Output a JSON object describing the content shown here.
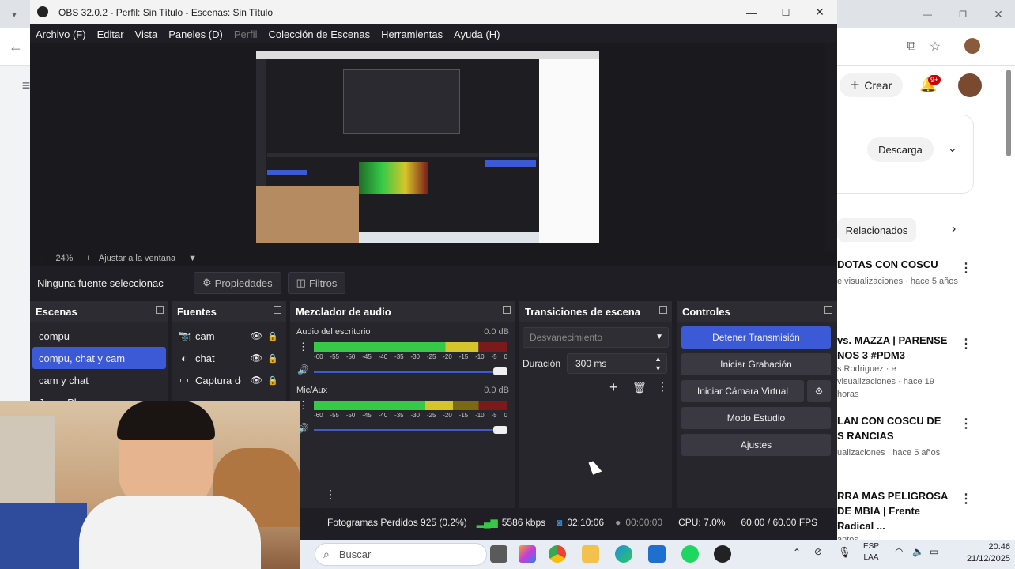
{
  "browser": {
    "create_label": "Crear",
    "notif_badge": "9+",
    "download_label": "Descarga",
    "related_label": "Relacionados",
    "videos": [
      {
        "title": "DOTAS CON COSCU",
        "meta": "e visualizaciones · hace 5 años"
      },
      {
        "title": "vs. MAZZA  | PARENSE NOS 3 #PDM3",
        "meta": "s Rodriguez · e visualizaciones · hace 19 horas"
      },
      {
        "title": "LAN CON COSCU DE S RANCIAS",
        "meta": "ualizaciones · hace 5 años"
      },
      {
        "title": "RRA MAS PELIGROSA DE MBIA | Frente Radical ...",
        "meta": "antos"
      }
    ]
  },
  "obs": {
    "window_title": "OBS 32.0.2 - Perfil: Sin Título - Escenas: Sin Título",
    "menu": [
      "Archivo (F)",
      "Editar",
      "Vista",
      "Paneles (D)",
      "Perfil",
      "Colección de Escenas",
      "Herramientas",
      "Ayuda (H)"
    ],
    "zoom": {
      "percent": "24%",
      "fit_label": "Ajustar a la ventana"
    },
    "no_source": "Ninguna fuente seleccionac",
    "properties_label": "Propiedades",
    "filters_label": "Filtros",
    "scenes": {
      "title": "Escenas",
      "items": [
        "compu",
        "compu, chat y cam",
        "cam y chat",
        "Jugar Play"
      ],
      "selected": 1
    },
    "sources": {
      "title": "Fuentes",
      "items": [
        {
          "name": "cam",
          "icon": "camera-icon"
        },
        {
          "name": "chat",
          "icon": "globe-icon"
        },
        {
          "name": "Captura de",
          "icon": "monitor-icon"
        }
      ]
    },
    "mixer": {
      "title": "Mezclador de audio",
      "channels": [
        {
          "name": "Audio del escritorio",
          "db": "0.0 dB",
          "level": 0.85
        },
        {
          "name": "Mic/Aux",
          "db": "0.0 dB",
          "level": 0.72
        }
      ],
      "scale": [
        "-60",
        "-55",
        "-50",
        "-45",
        "-40",
        "-35",
        "-30",
        "-25",
        "-20",
        "-15",
        "-10",
        "-5",
        "0"
      ]
    },
    "transitions": {
      "title": "Transiciones de escena",
      "selected": "Desvanecimiento",
      "duration_label": "Duración",
      "duration_value": "300 ms"
    },
    "controls": {
      "title": "Controles",
      "stop_stream": "Detener Transmisión",
      "start_recording": "Iniciar Grabación",
      "virtual_camera": "Iniciar Cámara Virtual",
      "studio_mode": "Modo Estudio",
      "settings": "Ajustes"
    },
    "status": {
      "dropped": "Fotogramas Perdidos 925 (0.2%)",
      "bitrate": "5586 kbps",
      "stream_time": "02:10:06",
      "rec_time": "00:00:00",
      "cpu": "CPU: 7.0%",
      "fps": "60.00 / 60.00 FPS"
    }
  },
  "taskbar": {
    "search_placeholder": "Buscar",
    "lang": "ESP",
    "layout": "LAA",
    "time": "20:46",
    "date": "21/12/2025"
  },
  "colors": {
    "accent": "#3c5ad5",
    "obs_bg": "#1f1e24"
  }
}
